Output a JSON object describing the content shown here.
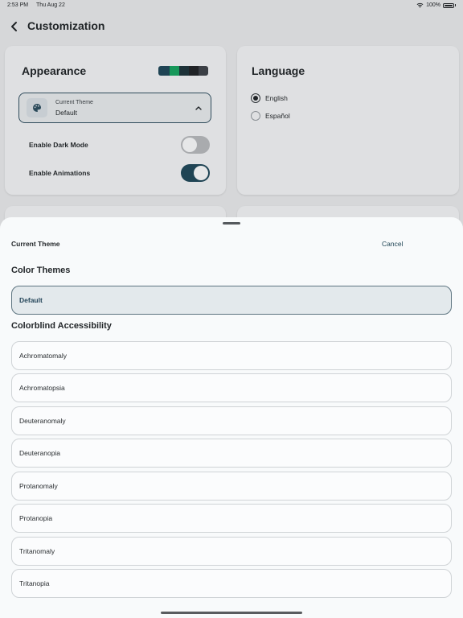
{
  "status_bar": {
    "time": "2:53 PM",
    "date": "Thu Aug 22",
    "battery": "100%",
    "icons": [
      "wifi-icon",
      "battery-icon"
    ]
  },
  "nav": {
    "title": "Customization",
    "back_icon": "chevron-left-icon"
  },
  "appearance": {
    "title": "Appearance",
    "swatch_colors": [
      "#1f4454",
      "#17985a",
      "#1d3238",
      "#202326",
      "#3b3f45"
    ],
    "theme_select": {
      "label": "Current Theme",
      "value": "Default",
      "icon": "palette-icon",
      "chevron": "chevron-up-icon"
    },
    "toggles": [
      {
        "label": "Enable Dark Mode",
        "on": false
      },
      {
        "label": "Enable Animations",
        "on": true
      }
    ]
  },
  "language": {
    "title": "Language",
    "options": [
      {
        "label": "English",
        "checked": true
      },
      {
        "label": "Español",
        "checked": false
      }
    ]
  },
  "sheet": {
    "title": "Current Theme",
    "cancel": "Cancel",
    "color_themes_heading": "Color Themes",
    "color_themes": [
      {
        "label": "Default",
        "selected": true
      }
    ],
    "accessibility_heading": "Colorblind Accessibility",
    "accessibility_themes": [
      {
        "label": "Achromatomaly"
      },
      {
        "label": "Achromatopsia"
      },
      {
        "label": "Deuteranomaly"
      },
      {
        "label": "Deuteranopia"
      },
      {
        "label": "Protanomaly"
      },
      {
        "label": "Protanopia"
      },
      {
        "label": "Tritanomaly"
      },
      {
        "label": "Tritanopia"
      }
    ]
  },
  "colors": {
    "accent": "#1f4454",
    "background_dimmed": "#d6d7d9",
    "sheet_background": "#f8fafb"
  }
}
